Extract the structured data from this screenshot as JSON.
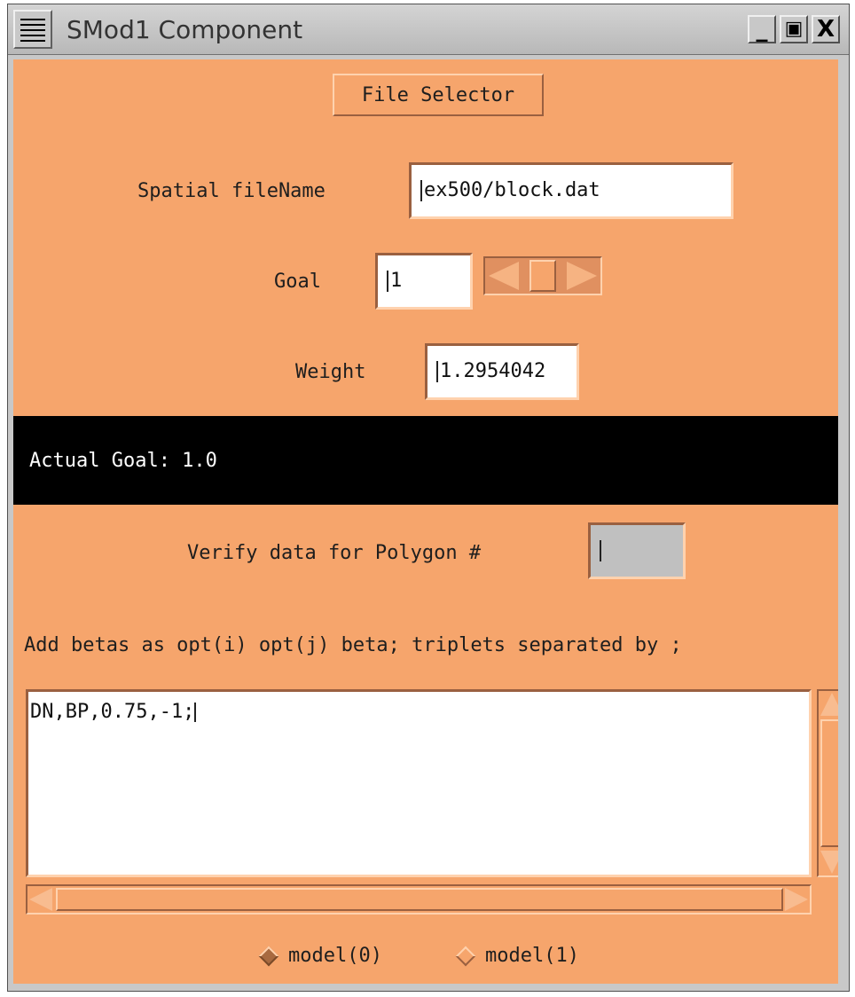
{
  "window": {
    "title": "SMod1 Component",
    "controls": {
      "minimize": "_",
      "maximize": "▣",
      "close": "X"
    }
  },
  "file_selector_label": "File Selector",
  "spatial": {
    "label": "Spatial fileName",
    "value": "ex500/block.dat"
  },
  "goal": {
    "label": "Goal",
    "value": "1"
  },
  "weight": {
    "label": "Weight",
    "value": "1.2954042"
  },
  "actual_goal": "Actual Goal: 1.0",
  "verify": {
    "label": "Verify data for Polygon #",
    "value": ""
  },
  "betas_instruction": "Add betas as opt(i) opt(j) beta; triplets separated by ;",
  "betas_text": "DN,BP,0.75,-1;",
  "models": [
    {
      "label": "model(0)",
      "selected": true
    },
    {
      "label": "model(1)",
      "selected": false
    }
  ],
  "colors": {
    "panel": "#f6a56c",
    "status_bar": "#000000"
  }
}
